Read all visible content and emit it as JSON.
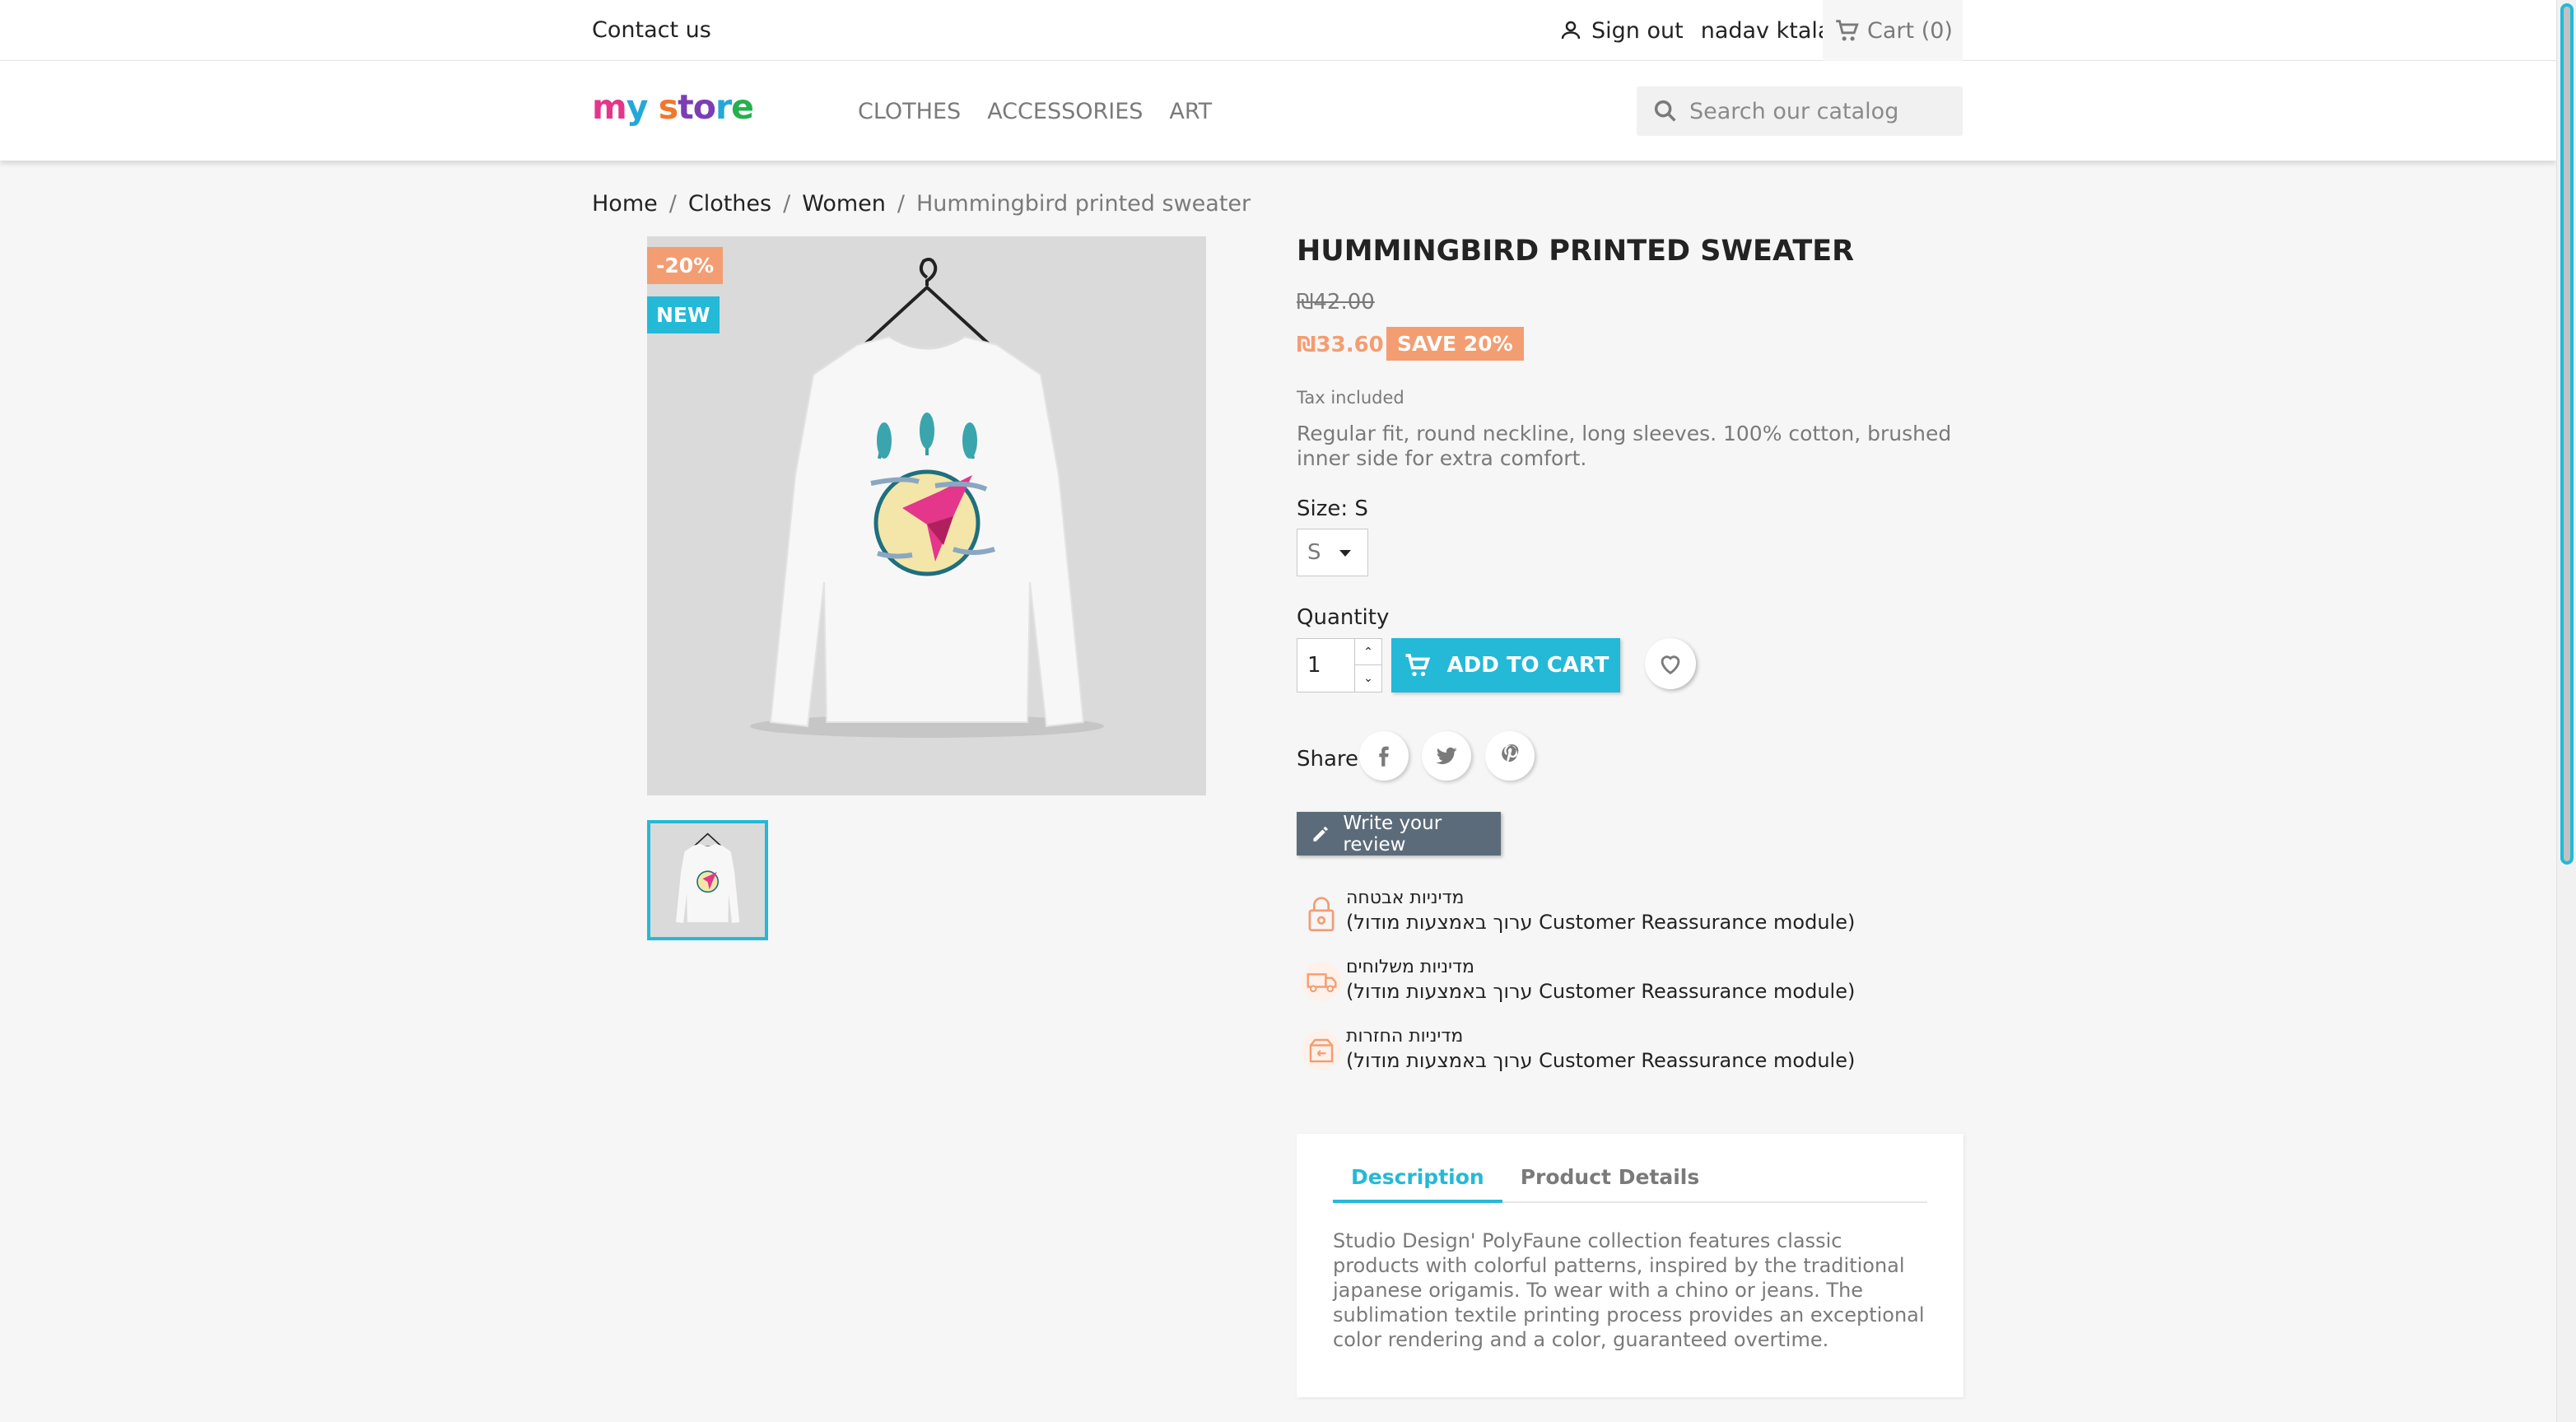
{
  "topbar": {
    "contact_label": "Contact us",
    "signout_label": "Sign out",
    "username": "nadav ktalav",
    "cart_label": "Cart",
    "cart_count": "(0)"
  },
  "header": {
    "logo_text_parts": [
      "my",
      " ",
      "s",
      "tor",
      "e"
    ],
    "logo_text": "my store",
    "nav": [
      "CLOTHES",
      "ACCESSORIES",
      "ART"
    ],
    "search_placeholder": "Search our catalog"
  },
  "breadcrumb": {
    "items": [
      "Home",
      "Clothes",
      "Women"
    ],
    "separator": "/",
    "current": "Hummingbird printed sweater"
  },
  "badges": {
    "discount": "-20%",
    "new": "NEW"
  },
  "product": {
    "title": "HUMMINGBIRD PRINTED SWEATER",
    "old_price": "₪42.00",
    "new_price": "₪33.60",
    "save_label": "SAVE 20%",
    "tax_note": "Tax included",
    "short_description": "Regular fit, round neckline, long sleeves. 100% cotton, brushed inner side for extra comfort.",
    "size_label": "Size: S",
    "size_selected": "S",
    "quantity_label": "Quantity",
    "quantity_value": "1",
    "add_to_cart_label": "ADD TO CART",
    "share_label": "Share",
    "review_label": "Write your review"
  },
  "reassurance": [
    {
      "title": "מדיניות אבטחה",
      "desc": "(ערוך באמצעות מודול Customer Reassurance module)",
      "icon": "lock-icon"
    },
    {
      "title": "מדיניות משלוחים",
      "desc": "(ערוך באמצעות מודול Customer Reassurance module)",
      "icon": "truck-icon"
    },
    {
      "title": "מדיניות החזרות",
      "desc": "(ערוך באמצעות מודול Customer Reassurance module)",
      "icon": "return-box-icon"
    }
  ],
  "tabs": {
    "items": [
      "Description",
      "Product Details"
    ],
    "active": "Description",
    "body": "Studio Design' PolyFaune collection features classic products with colorful patterns, inspired by the traditional japanese origamis. To wear with a chino or jeans. The sublimation textile printing process provides an exceptional color rendering and a color, guaranteed overtime."
  },
  "colors": {
    "accent": "#24b9d7",
    "discount": "#f39d72",
    "text": "#232323",
    "muted": "#7a7a7a",
    "review_button": "#5c6b7a"
  }
}
